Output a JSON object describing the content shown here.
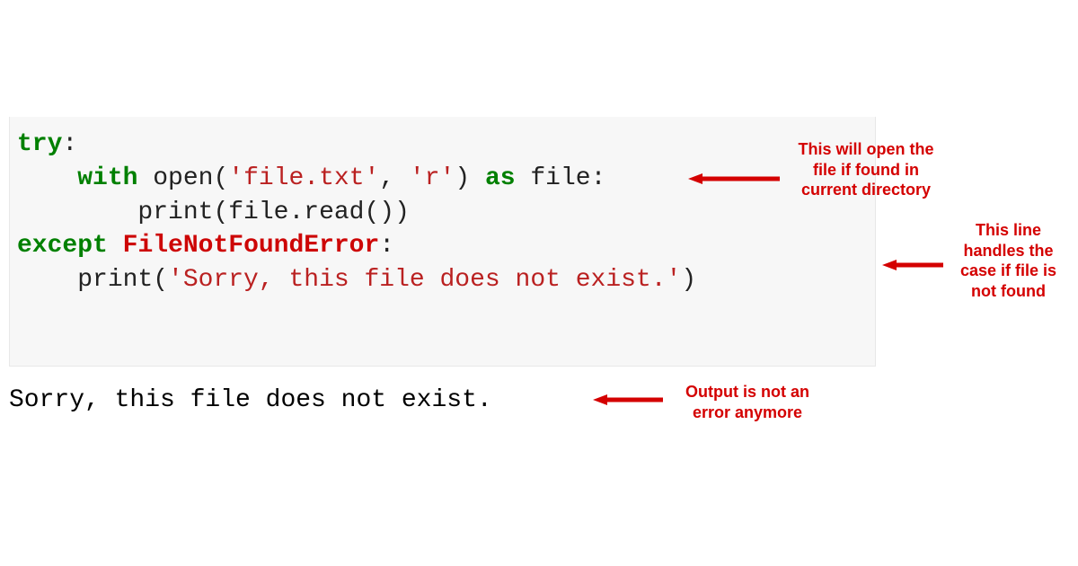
{
  "code": {
    "kw_try": "try",
    "kw_with": "with",
    "fn_open": "open",
    "str_filetxt": "'file.txt'",
    "str_r": "'r'",
    "kw_as": "as",
    "id_file": "file",
    "fn_print1": "print",
    "read_expr": "file.read()",
    "kw_except": "except",
    "exc_name": "FileNotFoundError",
    "fn_print2": "print",
    "str_sorry": "'Sorry, this file does not exist.'"
  },
  "output": "Sorry, this file does not exist.",
  "annotations": {
    "a1": "This will open the file if found in current directory",
    "a2": "This line handles the case if file is not found",
    "a3": "Output is not an error anymore"
  },
  "colors": {
    "annotation_red": "#d40000",
    "keyword_green": "#008000",
    "string_red": "#BA2121",
    "exception_red": "#CD0606",
    "code_bg": "#f7f7f7"
  }
}
